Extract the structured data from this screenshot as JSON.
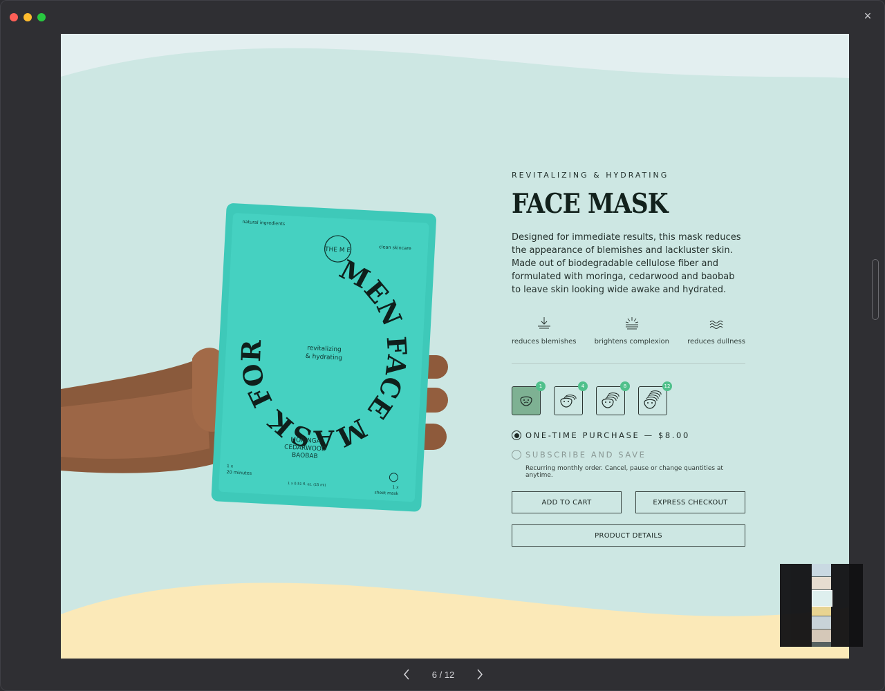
{
  "viewer": {
    "close_label": "×",
    "page_indicator": "6 / 12"
  },
  "slide": {
    "colors": {
      "sky": "#e3eff0",
      "main": "#cde7e3",
      "sand": "#fbe9b8",
      "packet": "#3ec9b9",
      "accent": "#4fc08b",
      "selected_pack": "#7eb193"
    },
    "packet": {
      "corner_top_left": "natural ingredients",
      "corner_top_right": "clean skincare",
      "logo": "THE M E",
      "ring_text": "MEN FACE MASK FOR",
      "center_text_1": "revitalizing",
      "center_text_2": "& hydrating",
      "ingredients_1": "MORINGA",
      "ingredients_2": "CEDARWOOD",
      "ingredients_3": "BAOBAB",
      "bottom_left_1": "1 x",
      "bottom_left_2": "20 minutes",
      "bottom_center": "1 x 0.51 fl. oz. (15 ml)",
      "bottom_right_1": "1 x",
      "bottom_right_2": "sheet mask"
    },
    "eyebrow": "REVITALIZING & HYDRATING",
    "title": "FACE MASK",
    "description": "Designed for immediate results, this mask reduces the appearance of blemishes and lackluster skin.  Made out of biodegradable cellulose fiber and formulated with moringa, cedarwood and baobab to leave skin looking wide awake and hydrated.",
    "benefits": [
      {
        "icon": "arrow-down-icon",
        "label": "reduces blemishes"
      },
      {
        "icon": "sunburst-icon",
        "label": "brightens complexion"
      },
      {
        "icon": "waves-icon",
        "label": "reduces dullness"
      }
    ],
    "packs": [
      {
        "count": "1",
        "icon": "face-mask-icon"
      },
      {
        "count": "4",
        "icon": "face-mask-stack-icon"
      },
      {
        "count": "8",
        "icon": "face-mask-stack-icon"
      },
      {
        "count": "12",
        "icon": "face-mask-stack-icon"
      }
    ],
    "option_one_time": "ONE-TIME PURCHASE — $8.00",
    "option_subscribe": "SUBSCRIBE AND SAVE",
    "subscribe_note": "Recurring monthly order. Cancel, pause or change quantities at anytime.",
    "btn_add_to_cart": "ADD TO CART",
    "btn_express": "EXPRESS CHECKOUT",
    "btn_details": "PRODUCT DETAILS"
  }
}
